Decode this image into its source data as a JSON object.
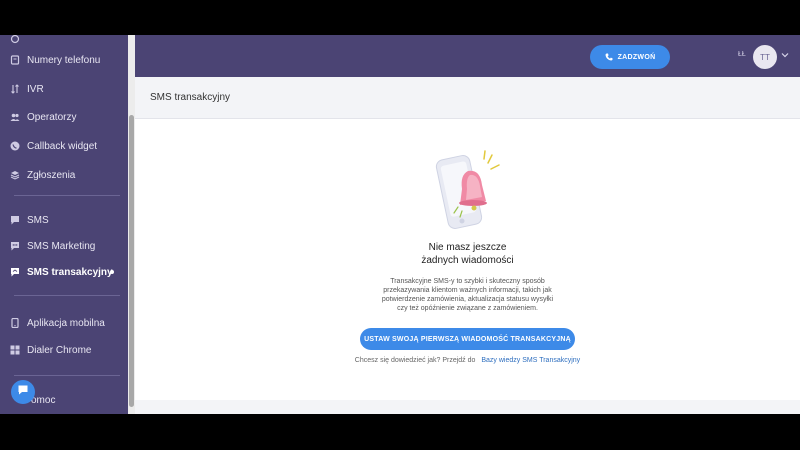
{
  "sidebar": {
    "items": [
      {
        "label": "Numery telefonu",
        "icon": "phone-book-icon"
      },
      {
        "label": "IVR",
        "icon": "ivr-icon"
      },
      {
        "label": "Operatorzy",
        "icon": "users-icon"
      },
      {
        "label": "Callback widget",
        "icon": "callback-icon"
      },
      {
        "label": "Zgłoszenia",
        "icon": "layers-icon"
      },
      {
        "label": "SMS",
        "icon": "message-icon"
      },
      {
        "label": "SMS Marketing",
        "icon": "message-icon"
      },
      {
        "label": "SMS transakcyjny",
        "icon": "message-icon"
      },
      {
        "label": "Aplikacja mobilna",
        "icon": "mobile-icon"
      },
      {
        "label": "Dialer Chrome",
        "icon": "grid-icon"
      },
      {
        "label": "omoc",
        "icon": "help-icon"
      }
    ]
  },
  "topbar": {
    "call_label": "ZADZWOŃ",
    "flag_text": "ŁŁ",
    "avatar_initials": "TT"
  },
  "page": {
    "title": "SMS transakcyjny"
  },
  "empty_state": {
    "title_line1": "Nie masz jeszcze",
    "title_line2": "żadnych wiadomości",
    "description": "Transakcyjne SMS-y to szybki i skuteczny sposób przekazywania klientom ważnych informacji, takich jak potwierdzenie zamówienia, aktualizacja statusu wysyłki czy też opóźnienie związane z zamówieniem.",
    "cta_label": "USTAW SWOJĄ PIERWSZĄ WIADOMOŚĆ TRANSAKCYJNĄ",
    "help_text": "Chcesz się dowiedzieć jak? Przejdź do",
    "help_link": "Bazy wiedzy SMS Transakcyjny"
  },
  "colors": {
    "sidebar_bg": "#4b4474",
    "accent": "#3d8ae8",
    "content_bg": "#ffffff"
  }
}
